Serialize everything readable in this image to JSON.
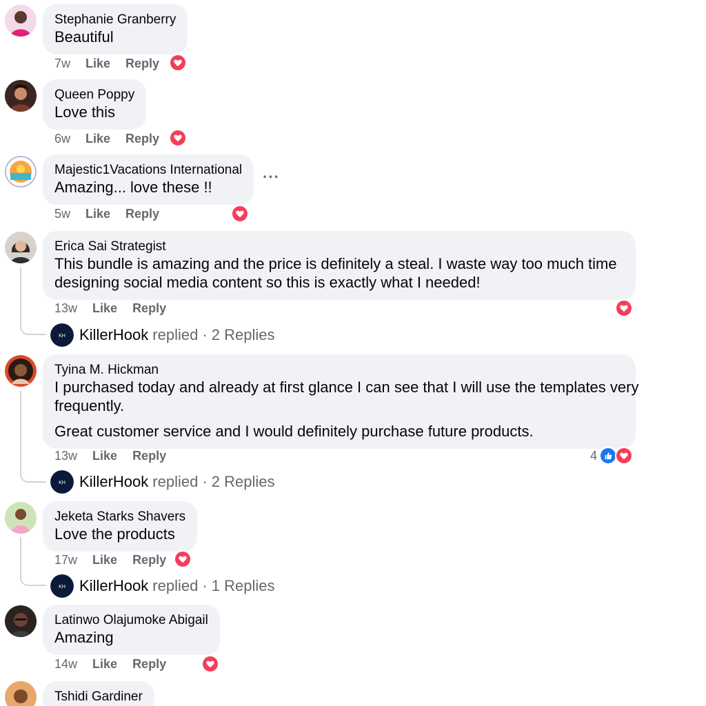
{
  "labels": {
    "like": "Like",
    "reply": "Reply",
    "replied": "replied ·"
  },
  "colors": {
    "love": "#f33e58",
    "like": "#1877f2",
    "bubble": "#f0f2f5",
    "meta": "#65676b"
  },
  "comments": [
    {
      "name": "Stephanie Granberry",
      "text": [
        "Beautiful"
      ],
      "time": "7w",
      "reactions": [
        "love"
      ]
    },
    {
      "name": "Queen Poppy",
      "text": [
        "Love this"
      ],
      "time": "6w",
      "reactions": [
        "love"
      ]
    },
    {
      "name": "Majestic1Vacations International",
      "text": [
        "Amazing... love these !!"
      ],
      "time": "5w",
      "reactions": [
        "love"
      ],
      "more": "···"
    },
    {
      "name": "Erica Sai Strategist",
      "text": [
        "This bundle is amazing and the price is definitely a steal. I waste way too much time",
        "designing social media content so this is exactly what I needed!"
      ],
      "time": "13w",
      "reactions": [
        "love"
      ],
      "reply": {
        "name": "KillerHook",
        "summary": "2 Replies"
      }
    },
    {
      "name": "Tyina M. Hickman",
      "text": [
        "I purchased today and already at first glance I can see that I will use the templates very",
        "frequently.",
        "Great customer service and I would definitely purchase future products."
      ],
      "time": "13w",
      "reactions": [
        "like",
        "love"
      ],
      "reaction_count": "4",
      "reply": {
        "name": "KillerHook",
        "summary": "2 Replies"
      }
    },
    {
      "name": "Jeketa Starks Shavers",
      "text": [
        "Love the products"
      ],
      "time": "17w",
      "reactions": [
        "love"
      ],
      "reply": {
        "name": "KillerHook",
        "summary": "1 Replies"
      }
    },
    {
      "name": "Latinwo Olajumoke Abigail",
      "text": [
        "Amazing"
      ],
      "time": "14w",
      "reactions": [
        "love"
      ]
    },
    {
      "name": "Tshidi Gardiner",
      "text": [],
      "time": "",
      "reactions": []
    }
  ]
}
